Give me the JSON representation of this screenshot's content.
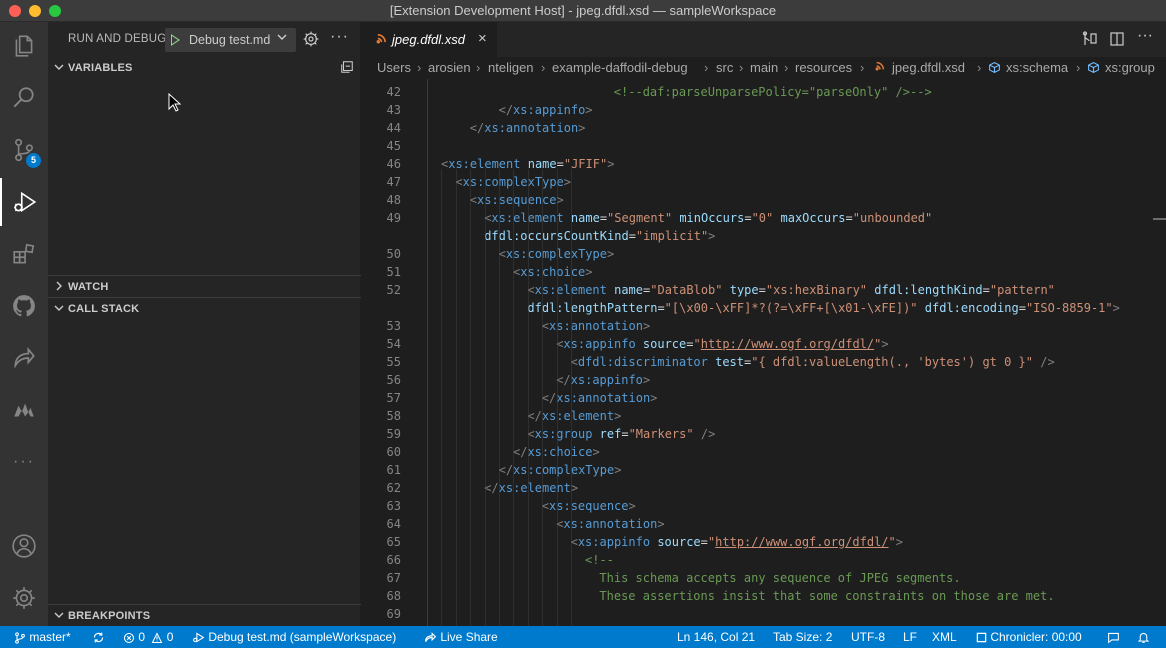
{
  "window": {
    "title": "[Extension Development Host] - jpeg.dfdl.xsd — sampleWorkspace"
  },
  "activity_bar": {
    "items": [
      "explorer-icon",
      "search-icon",
      "source-control-icon",
      "run-debug-icon",
      "extensions-icon",
      "github-icon",
      "live-share-icon",
      "daffodil-icon",
      "more-icon",
      "account-icon",
      "manage-gear-icon"
    ],
    "source_control_badge": "5",
    "more_label": "···"
  },
  "sidebar": {
    "run_title": "RUN AND DEBUG",
    "debug_config": "Debug test.md",
    "more_label": "···",
    "sections": {
      "variables": "VARIABLES",
      "watch": "WATCH",
      "call_stack": "CALL STACK",
      "breakpoints": "BREAKPOINTS"
    }
  },
  "editor": {
    "tab": {
      "label": "jpeg.dfdl.xsd",
      "icon": "rss-icon",
      "close": "×"
    },
    "breadcrumb": {
      "items": [
        "Users",
        "arosien",
        "nteligen",
        "example-daffodil-debug",
        "src",
        "main",
        "resources",
        "jpeg.dfdl.xsd",
        "xs:schema",
        "xs:group"
      ]
    }
  },
  "code_lines": [
    {
      "n": "",
      "indent": 2,
      "html": ""
    },
    {
      "n": "42",
      "indent": 12,
      "parts": [
        [
          "com",
          "<!--daf:parseUnparsePolicy=\"parseOnly\" />-->"
        ]
      ]
    },
    {
      "n": "43",
      "indent": 4,
      "parts": [
        [
          "punc",
          "</"
        ],
        [
          "tag",
          "xs:appinfo"
        ],
        [
          "punc",
          ">"
        ]
      ]
    },
    {
      "n": "44",
      "indent": 2,
      "parts": [
        [
          "punc",
          "</"
        ],
        [
          "tag",
          "xs:annotation"
        ],
        [
          "punc",
          ">"
        ]
      ]
    },
    {
      "n": "45",
      "indent": 0,
      "parts": []
    },
    {
      "n": "46",
      "indent": 0,
      "parts": [
        [
          "punc",
          "<"
        ],
        [
          "tag",
          "xs:element"
        ],
        [
          "text",
          " "
        ],
        [
          "attr",
          "name"
        ],
        [
          "text",
          "="
        ],
        [
          "str",
          "\"JFIF\""
        ],
        [
          "punc",
          ">"
        ]
      ]
    },
    {
      "n": "47",
      "indent": 1,
      "parts": [
        [
          "punc",
          "<"
        ],
        [
          "tag",
          "xs:complexType"
        ],
        [
          "punc",
          ">"
        ]
      ]
    },
    {
      "n": "48",
      "indent": 2,
      "parts": [
        [
          "punc",
          "<"
        ],
        [
          "tag",
          "xs:sequence"
        ],
        [
          "punc",
          ">"
        ]
      ]
    },
    {
      "n": "49",
      "indent": 3,
      "parts": [
        [
          "punc",
          "<"
        ],
        [
          "tag",
          "xs:element"
        ],
        [
          "text",
          " "
        ],
        [
          "attr",
          "name"
        ],
        [
          "text",
          "="
        ],
        [
          "str",
          "\"Segment\""
        ],
        [
          "text",
          " "
        ],
        [
          "attr",
          "minOccurs"
        ],
        [
          "text",
          "="
        ],
        [
          "str",
          "\"0\""
        ],
        [
          "text",
          " "
        ],
        [
          "attr",
          "maxOccurs"
        ],
        [
          "text",
          "="
        ],
        [
          "str",
          "\"unbounded\""
        ]
      ]
    },
    {
      "n": "",
      "indent": 3,
      "parts": [
        [
          "attr",
          "dfdl:occursCountKind"
        ],
        [
          "text",
          "="
        ],
        [
          "str",
          "\"implicit\""
        ],
        [
          "punc",
          ">"
        ]
      ]
    },
    {
      "n": "50",
      "indent": 4,
      "parts": [
        [
          "punc",
          "<"
        ],
        [
          "tag",
          "xs:complexType"
        ],
        [
          "punc",
          ">"
        ]
      ]
    },
    {
      "n": "51",
      "indent": 5,
      "parts": [
        [
          "punc",
          "<"
        ],
        [
          "tag",
          "xs:choice"
        ],
        [
          "punc",
          ">"
        ]
      ]
    },
    {
      "n": "52",
      "indent": 6,
      "parts": [
        [
          "punc",
          "<"
        ],
        [
          "tag",
          "xs:element"
        ],
        [
          "text",
          " "
        ],
        [
          "attr",
          "name"
        ],
        [
          "text",
          "="
        ],
        [
          "str",
          "\"DataBlob\""
        ],
        [
          "text",
          " "
        ],
        [
          "attr",
          "type"
        ],
        [
          "text",
          "="
        ],
        [
          "str",
          "\"xs:hexBinary\""
        ],
        [
          "text",
          " "
        ],
        [
          "attr",
          "dfdl:lengthKind"
        ],
        [
          "text",
          "="
        ],
        [
          "str",
          "\"pattern\""
        ]
      ]
    },
    {
      "n": "",
      "indent": 6,
      "parts": [
        [
          "attr",
          "dfdl:lengthPattern"
        ],
        [
          "text",
          "="
        ],
        [
          "str",
          "\"[\\x00-\\xFF]*?(?=\\xFF+[\\x01-\\xFE])\""
        ],
        [
          "text",
          " "
        ],
        [
          "attr",
          "dfdl:encoding"
        ],
        [
          "text",
          "="
        ],
        [
          "str",
          "\"ISO-8859-1\""
        ],
        [
          "punc",
          ">"
        ]
      ]
    },
    {
      "n": "53",
      "indent": 7,
      "parts": [
        [
          "punc",
          "<"
        ],
        [
          "tag",
          "xs:annotation"
        ],
        [
          "punc",
          ">"
        ]
      ]
    },
    {
      "n": "54",
      "indent": 8,
      "parts": [
        [
          "punc",
          "<"
        ],
        [
          "tag",
          "xs:appinfo"
        ],
        [
          "text",
          " "
        ],
        [
          "attr",
          "source"
        ],
        [
          "text",
          "="
        ],
        [
          "str",
          "\""
        ],
        [
          "url",
          "http://www.ogf.org/dfdl/"
        ],
        [
          "str",
          "\""
        ],
        [
          "punc",
          ">"
        ]
      ]
    },
    {
      "n": "55",
      "indent": 9,
      "parts": [
        [
          "punc",
          "<"
        ],
        [
          "tag",
          "dfdl:discriminator"
        ],
        [
          "text",
          " "
        ],
        [
          "attr",
          "test"
        ],
        [
          "text",
          "="
        ],
        [
          "str",
          "\"{ dfdl:valueLength(., 'bytes') gt 0 }\""
        ],
        [
          "text",
          " "
        ],
        [
          "punc",
          "/>"
        ]
      ]
    },
    {
      "n": "56",
      "indent": 8,
      "parts": [
        [
          "punc",
          "</"
        ],
        [
          "tag",
          "xs:appinfo"
        ],
        [
          "punc",
          ">"
        ]
      ]
    },
    {
      "n": "57",
      "indent": 7,
      "parts": [
        [
          "punc",
          "</"
        ],
        [
          "tag",
          "xs:annotation"
        ],
        [
          "punc",
          ">"
        ]
      ]
    },
    {
      "n": "58",
      "indent": 6,
      "parts": [
        [
          "punc",
          "</"
        ],
        [
          "tag",
          "xs:element"
        ],
        [
          "punc",
          ">"
        ]
      ]
    },
    {
      "n": "59",
      "indent": 6,
      "parts": [
        [
          "punc",
          "<"
        ],
        [
          "tag",
          "xs:group"
        ],
        [
          "text",
          " "
        ],
        [
          "attr",
          "ref"
        ],
        [
          "text",
          "="
        ],
        [
          "str",
          "\"Markers\""
        ],
        [
          "text",
          " "
        ],
        [
          "punc",
          "/>"
        ]
      ]
    },
    {
      "n": "60",
      "indent": 5,
      "parts": [
        [
          "punc",
          "</"
        ],
        [
          "tag",
          "xs:choice"
        ],
        [
          "punc",
          ">"
        ]
      ]
    },
    {
      "n": "61",
      "indent": 4,
      "parts": [
        [
          "punc",
          "</"
        ],
        [
          "tag",
          "xs:complexType"
        ],
        [
          "punc",
          ">"
        ]
      ]
    },
    {
      "n": "62",
      "indent": 3,
      "parts": [
        [
          "punc",
          "</"
        ],
        [
          "tag",
          "xs:element"
        ],
        [
          "punc",
          ">"
        ]
      ]
    },
    {
      "n": "63",
      "indent": 7,
      "parts": [
        [
          "punc",
          "<"
        ],
        [
          "tag",
          "xs:sequence"
        ],
        [
          "punc",
          ">"
        ]
      ]
    },
    {
      "n": "64",
      "indent": 8,
      "parts": [
        [
          "punc",
          "<"
        ],
        [
          "tag",
          "xs:annotation"
        ],
        [
          "punc",
          ">"
        ]
      ]
    },
    {
      "n": "65",
      "indent": 9,
      "parts": [
        [
          "punc",
          "<"
        ],
        [
          "tag",
          "xs:appinfo"
        ],
        [
          "text",
          " "
        ],
        [
          "attr",
          "source"
        ],
        [
          "text",
          "="
        ],
        [
          "str",
          "\""
        ],
        [
          "url",
          "http://www.ogf.org/dfdl/"
        ],
        [
          "str",
          "\""
        ],
        [
          "punc",
          ">"
        ]
      ]
    },
    {
      "n": "66",
      "indent": 10,
      "parts": [
        [
          "com",
          "<!--"
        ]
      ]
    },
    {
      "n": "67",
      "indent": 11,
      "parts": [
        [
          "com",
          "This schema accepts any sequence of JPEG segments."
        ]
      ]
    },
    {
      "n": "68",
      "indent": 11,
      "parts": [
        [
          "com",
          "These assertions insist that some constraints on those are met."
        ]
      ]
    },
    {
      "n": "69",
      "indent": 0,
      "parts": []
    }
  ],
  "status_bar": {
    "branch": "master*",
    "errors": "0",
    "warnings": "0",
    "debug": "Debug test.md (sampleWorkspace)",
    "live_share": "Live Share",
    "position": "Ln 146, Col 21",
    "tab_size": "Tab Size: 2",
    "encoding": "UTF-8",
    "eol": "LF",
    "language": "XML",
    "chronicler": "Chronicler: 00:00"
  }
}
